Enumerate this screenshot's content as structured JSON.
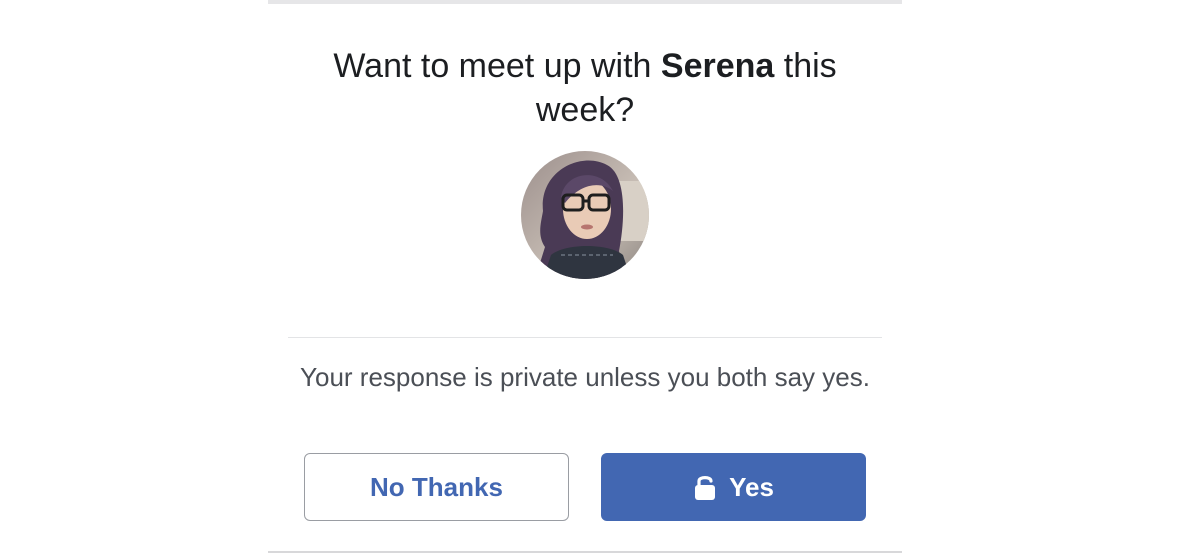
{
  "prompt": {
    "before": "Want to meet up with ",
    "name": "Serena",
    "after": " this week?"
  },
  "avatar": {
    "icon": "profile-photo",
    "colors": {
      "hair": "#4a3a55",
      "skin": "#e9cbb6",
      "background": "#b9ada5"
    }
  },
  "privacy_text": "Your response is private unless you both say yes.",
  "buttons": {
    "no_label": "No Thanks",
    "yes_label": "Yes",
    "yes_icon": "lock-icon"
  },
  "colors": {
    "accent": "#4267b2",
    "text_primary": "#1c1e21",
    "text_secondary": "#4b4f56",
    "border": "#9a9da3",
    "divider": "#e3e4e6"
  }
}
